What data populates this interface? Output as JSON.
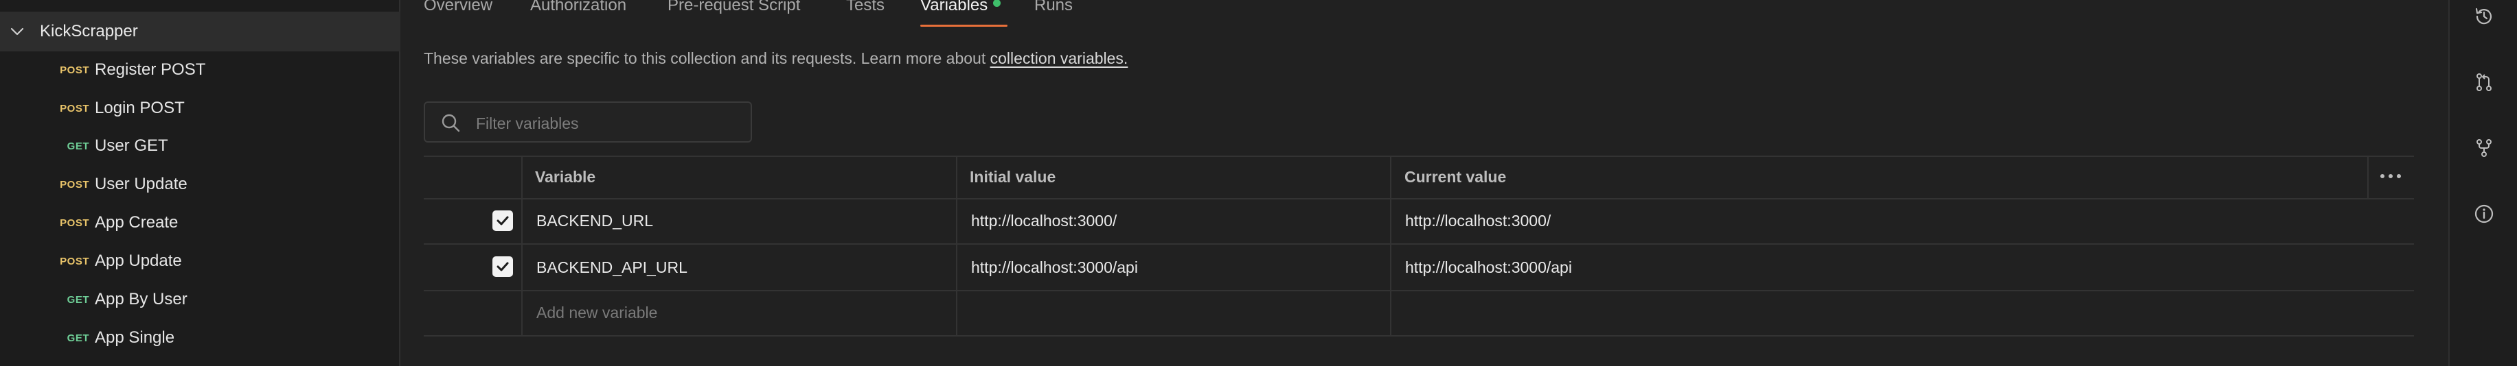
{
  "sidebar": {
    "collection_name": "KickScrapper",
    "requests": [
      {
        "method": "POST",
        "label": "Register POST"
      },
      {
        "method": "POST",
        "label": "Login POST"
      },
      {
        "method": "GET",
        "label": "User GET"
      },
      {
        "method": "POST",
        "label": "User Update"
      },
      {
        "method": "POST",
        "label": "App Create"
      },
      {
        "method": "POST",
        "label": "App Update"
      },
      {
        "method": "GET",
        "label": "App By User"
      },
      {
        "method": "GET",
        "label": "App Single"
      }
    ]
  },
  "tabs": [
    {
      "label": "Overview"
    },
    {
      "label": "Authorization"
    },
    {
      "label": "Pre-request Script"
    },
    {
      "label": "Tests"
    },
    {
      "label": "Variables"
    },
    {
      "label": "Runs"
    }
  ],
  "description": {
    "text": "These variables are specific to this collection and its requests. Learn more about ",
    "link": "collection variables."
  },
  "filter": {
    "placeholder": "Filter variables"
  },
  "table": {
    "headers": [
      "Variable",
      "Initial value",
      "Current value"
    ],
    "rows": [
      {
        "checked": true,
        "variable": "BACKEND_URL",
        "initial": "http://localhost:3000/",
        "current": "http://localhost:3000/"
      },
      {
        "checked": true,
        "variable": "BACKEND_API_URL",
        "initial": "http://localhost:3000/api",
        "current": "http://localhost:3000/api"
      }
    ],
    "new_placeholder": "Add new variable"
  },
  "colors": {
    "accent": "#e8703a",
    "post_method": "#e9c46a",
    "get_method": "#6fcf97",
    "status_dot": "#3fbf6b"
  },
  "rail_icons": [
    "history-icon",
    "pull-request-icon",
    "fork-icon",
    "info-icon"
  ]
}
